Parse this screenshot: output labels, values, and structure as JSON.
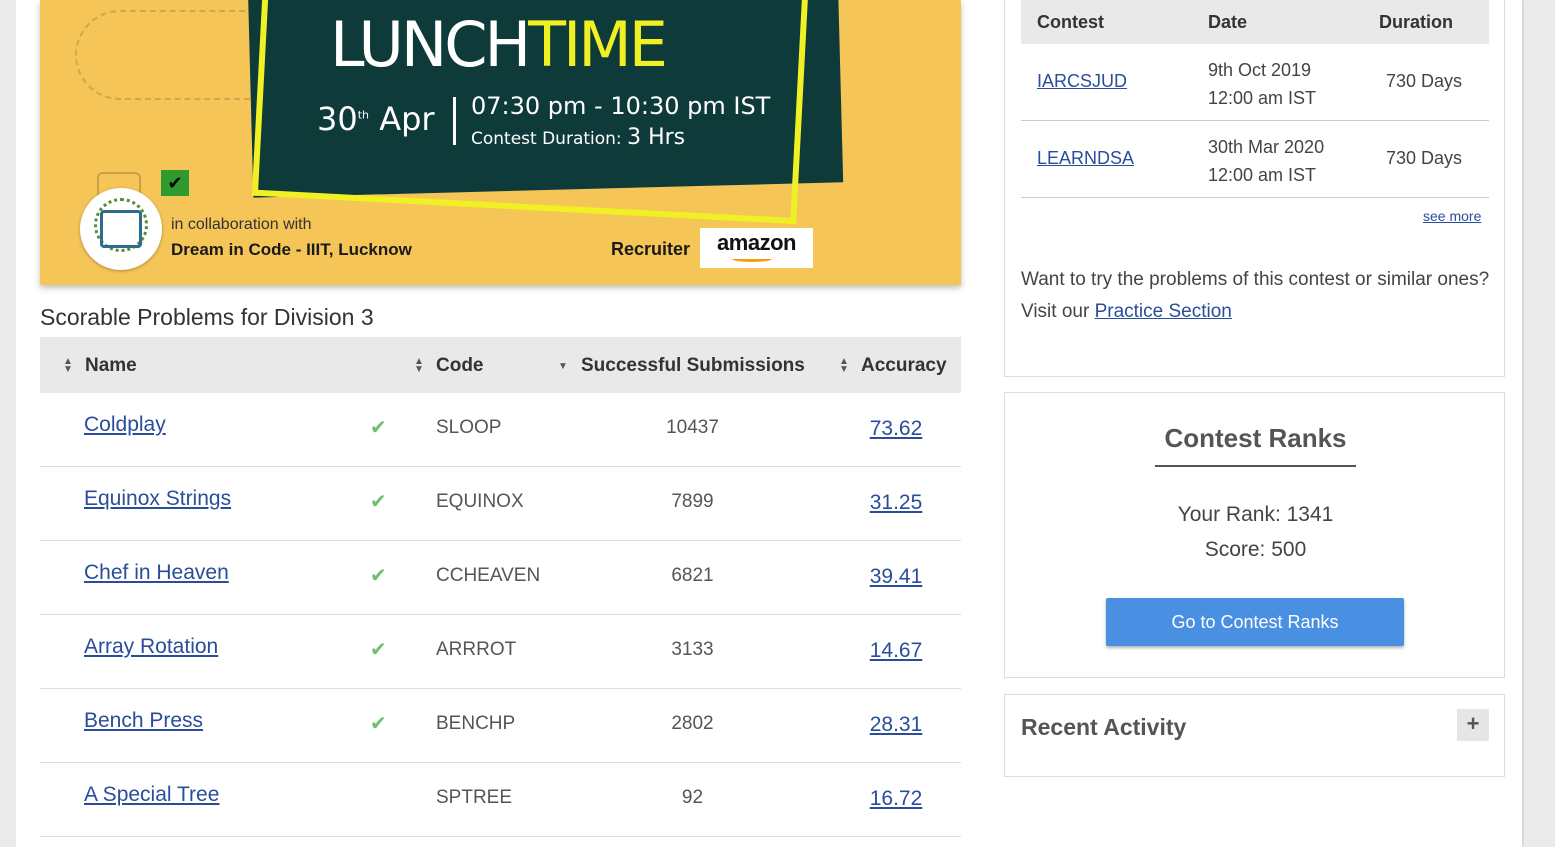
{
  "banner": {
    "lunch": "LUNCH",
    "time": "TIME",
    "date_day": "30",
    "date_sup": "th",
    "date_month": "Apr",
    "time_range": "07:30 pm - 10:30 pm IST",
    "duration_label": "Contest Duration:",
    "duration_value": "3 Hrs",
    "collab_label": "in collaboration with",
    "collab_name": "Dream in Code - IIIT, Lucknow",
    "recruiter_label": "Recruiter",
    "recruiter_name": "amazon"
  },
  "problems": {
    "title": "Scorable Problems for Division 3",
    "headers": {
      "name": "Name",
      "code": "Code",
      "submissions": "Successful Submissions",
      "accuracy": "Accuracy"
    },
    "rows": [
      {
        "name": "Coldplay",
        "solved": true,
        "code": "SLOOP",
        "submissions": "10437",
        "accuracy": "73.62"
      },
      {
        "name": "Equinox Strings",
        "solved": true,
        "code": "EQUINOX",
        "submissions": "7899",
        "accuracy": "31.25"
      },
      {
        "name": "Chef in Heaven",
        "solved": true,
        "code": "CCHEAVEN",
        "submissions": "6821",
        "accuracy": "39.41"
      },
      {
        "name": "Array Rotation",
        "solved": true,
        "code": "ARRROT",
        "submissions": "3133",
        "accuracy": "14.67"
      },
      {
        "name": "Bench Press",
        "solved": true,
        "code": "BENCHP",
        "submissions": "2802",
        "accuracy": "28.31"
      },
      {
        "name": "A Special Tree",
        "solved": false,
        "code": "SPTREE",
        "submissions": "92",
        "accuracy": "16.72"
      }
    ]
  },
  "contests": {
    "headers": {
      "contest": "Contest",
      "date": "Date",
      "duration": "Duration"
    },
    "rows": [
      {
        "contest": "IARCSJUD",
        "date_line1": "9th Oct 2019",
        "date_line2": "12:00 am IST",
        "duration": "730 Days"
      },
      {
        "contest": "LEARNDSA",
        "date_line1": "30th Mar 2020",
        "date_line2": "12:00 am IST",
        "duration": "730 Days"
      }
    ],
    "see_more": "see more",
    "practice_text": "Want to try the problems of this contest or similar ones? Visit our",
    "practice_link": "Practice Section"
  },
  "ranks": {
    "title": "Contest Ranks",
    "your_rank": "Your Rank: 1341",
    "score": "Score: 500",
    "button": "Go to Contest Ranks"
  },
  "activity": {
    "title": "Recent Activity",
    "toggle": "+"
  },
  "colors": {
    "accent": "#4a90e2",
    "link": "#2a4d9b",
    "check": "#6fbf6f",
    "banner_bg": "#f5c557",
    "banner_card": "#0e3a3a",
    "banner_yellow": "#f0f024"
  }
}
